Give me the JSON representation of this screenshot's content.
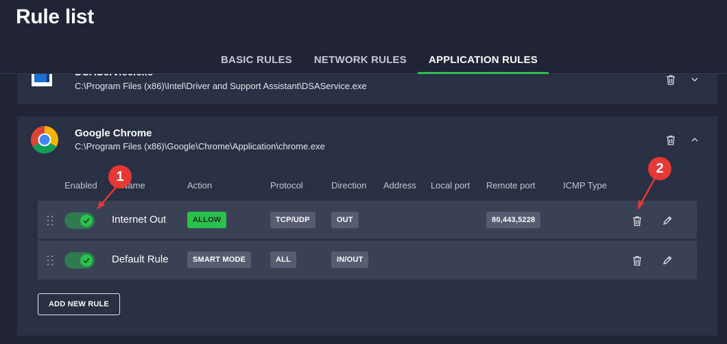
{
  "page": {
    "title": "Rule list"
  },
  "tabs": [
    {
      "label": "BASIC RULES",
      "active": false
    },
    {
      "label": "NETWORK RULES",
      "active": false
    },
    {
      "label": "APPLICATION RULES",
      "active": true
    }
  ],
  "apps": {
    "dsa": {
      "name": "DSAService.exe",
      "path": "C:\\Program Files (x86)\\Intel\\Driver and Support Assistant\\DSAService.exe",
      "icon": "dsa-app-icon"
    },
    "chrome": {
      "name": "Google Chrome",
      "path": "C:\\Program Files (x86)\\Google\\Chrome\\Application\\chrome.exe",
      "icon": "chrome-icon"
    }
  },
  "columns": {
    "enabled": "Enabled",
    "name": "Name",
    "action": "Action",
    "protocol": "Protocol",
    "direction": "Direction",
    "address": "Address",
    "local_port": "Local port",
    "remote_port": "Remote port",
    "icmp_type": "ICMP Type"
  },
  "rules": [
    {
      "enabled": true,
      "name": "Internet Out",
      "action": "ALLOW",
      "protocol": "TCP/UDP",
      "direction": "OUT",
      "address": "",
      "local_port": "",
      "remote_port": "80,443,5228",
      "icmp_type": ""
    },
    {
      "enabled": true,
      "name": "Default Rule",
      "action": "SMART MODE",
      "protocol": "ALL",
      "direction": "IN/OUT",
      "address": "",
      "local_port": "",
      "remote_port": "",
      "icmp_type": ""
    }
  ],
  "add_rule_label": "ADD NEW RULE",
  "annotations": {
    "one": "1",
    "two": "2"
  },
  "colors": {
    "accent": "#28c24d",
    "background": "#1f2537",
    "card": "#2a3044",
    "row": "#3a4055",
    "marker": "#e53935"
  }
}
